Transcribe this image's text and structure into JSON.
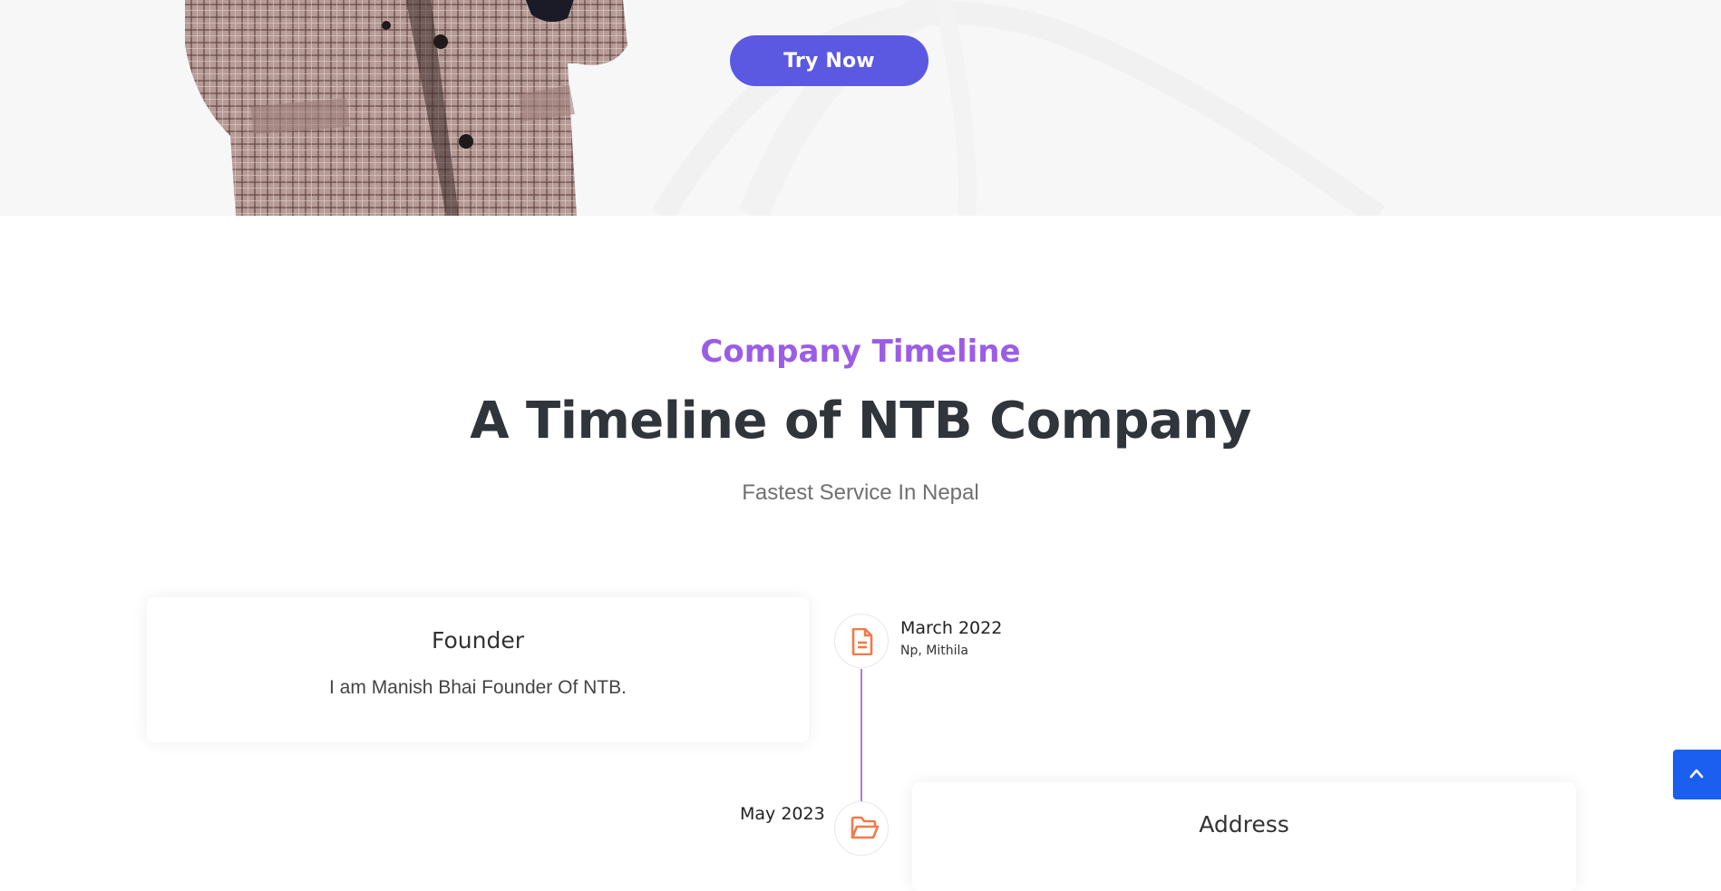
{
  "hero": {
    "cta_label": "Try Now",
    "accent_color": "#5b58e2"
  },
  "section": {
    "eyebrow": "Company Timeline",
    "title": "A Timeline of NTB Company",
    "subtitle": "Fastest Service In Nepal"
  },
  "timeline": {
    "items": [
      {
        "title": "Founder",
        "text": "I am Manish Bhai Founder Of NTB.",
        "date": "March 2022",
        "place": "Np, Mithila",
        "icon": "file-text-icon"
      },
      {
        "title": "Address",
        "date": "May 2023",
        "icon": "folder-open-icon"
      }
    ],
    "line_color": "#a779e9",
    "icon_color": "#f07a4a"
  },
  "back_to_top": {
    "icon": "chevron-up-icon",
    "color": "#1a5fef"
  }
}
